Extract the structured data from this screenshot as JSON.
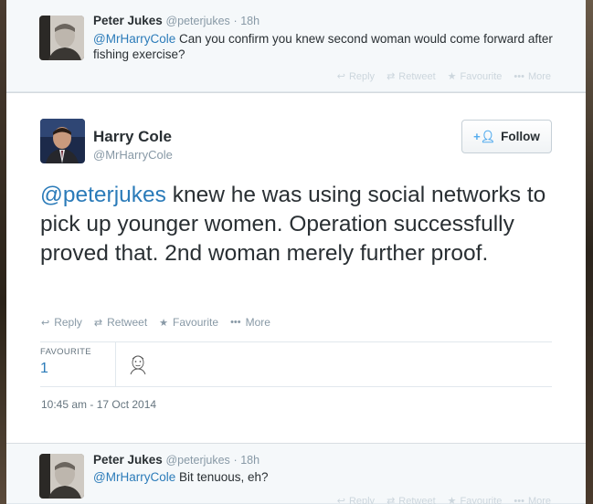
{
  "tweet_top": {
    "fullname": "Peter Jukes",
    "username": "@peterjukes",
    "dot": "·",
    "time": "18h",
    "mention": "@MrHarryCole",
    "text": " Can you confirm you knew second woman would come forward after fishing exercise?",
    "actions": {
      "reply": "Reply",
      "retweet": "Retweet",
      "favourite": "Favourite",
      "more": "More"
    }
  },
  "tweet_main": {
    "fullname": "Harry Cole",
    "username": "@MrHarryCole",
    "follow_label": "Follow",
    "mention": "@peterjukes",
    "text": " knew he was using social networks to pick up younger women. Operation successfully proved that. 2nd woman merely further proof.",
    "actions": {
      "reply": "Reply",
      "retweet": "Retweet",
      "favourite": "Favourite",
      "more": "More"
    },
    "stats": {
      "favourite_label": "FAVOURITE",
      "favourite_count": "1"
    },
    "timestamp": "10:45 am - 17 Oct 2014"
  },
  "tweet_bottom": {
    "fullname": "Peter Jukes",
    "username": "@peterjukes",
    "dot": "·",
    "time": "18h",
    "mention": "@MrHarryCole",
    "text": " Bit tenuous, eh?",
    "actions": {
      "reply": "Reply",
      "retweet": "Retweet",
      "favourite": "Favourite",
      "more": "More"
    }
  },
  "icons": {
    "reply": "reply-icon",
    "retweet": "retweet-icon",
    "favourite": "star-icon",
    "more": "more-dots-icon",
    "follow": "add-person-icon"
  },
  "colors": {
    "link": "#2b7bb9",
    "muted": "#8899a6",
    "text": "#292f33",
    "follow_icon": "#55acee"
  }
}
